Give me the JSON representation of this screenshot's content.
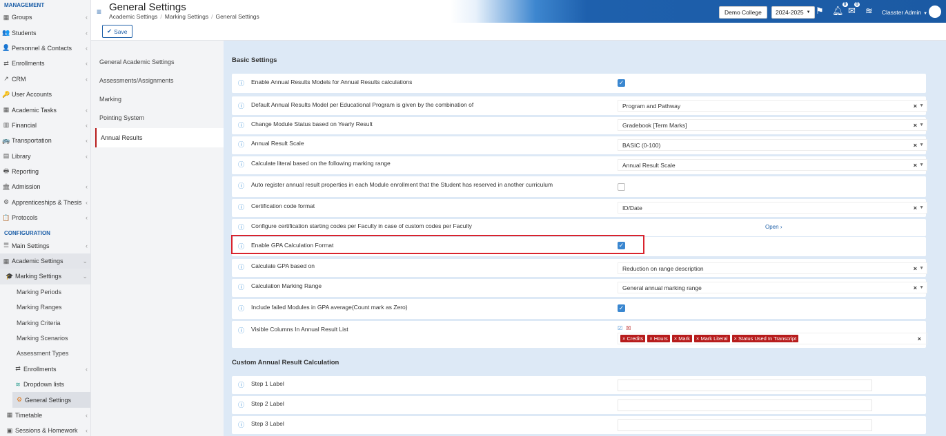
{
  "sidebar": {
    "management_heading": "MANAGEMENT",
    "configuration_heading": "CONFIGURATION",
    "management_items": [
      {
        "label": "Groups",
        "icon": "groups-icon"
      },
      {
        "label": "Students",
        "icon": "students-icon"
      },
      {
        "label": "Personnel & Contacts",
        "icon": "personnel-icon"
      },
      {
        "label": "Enrollments",
        "icon": "enrollments-icon"
      },
      {
        "label": "CRM",
        "icon": "crm-icon"
      },
      {
        "label": "User Accounts",
        "icon": "user-accounts-icon"
      },
      {
        "label": "Academic Tasks",
        "icon": "academic-tasks-icon"
      },
      {
        "label": "Financial",
        "icon": "financial-icon"
      },
      {
        "label": "Transportation",
        "icon": "transportation-icon"
      },
      {
        "label": "Library",
        "icon": "library-icon"
      },
      {
        "label": "Reporting",
        "icon": "reporting-icon"
      },
      {
        "label": "Admission",
        "icon": "admission-icon"
      },
      {
        "label": "Apprenticeships & Thesis",
        "icon": "apprenticeships-icon"
      },
      {
        "label": "Protocols",
        "icon": "protocols-icon"
      }
    ],
    "config_items": {
      "main_settings": "Main Settings",
      "academic_settings": "Academic Settings",
      "marking_settings": "Marking Settings",
      "marking_periods": "Marking Periods",
      "marking_ranges": "Marking Ranges",
      "marking_criteria": "Marking Criteria",
      "marking_scenarios": "Marking Scenarios",
      "assessment_types": "Assessment Types",
      "enrollments": "Enrollments",
      "dropdown_lists": "Dropdown lists",
      "general_settings": "General Settings",
      "timetable": "Timetable",
      "sessions_homework": "Sessions & Homework"
    }
  },
  "header": {
    "title": "General Settings",
    "breadcrumb": [
      "Academic Settings",
      "Marking Settings",
      "General Settings"
    ],
    "college": "Demo College",
    "year": "2024-2025",
    "notif_count": "0",
    "mail_count": "0",
    "user": "Classter Admin"
  },
  "toolbar": {
    "save_label": "Save"
  },
  "settings_nav": [
    "General Academic Settings",
    "Assessments/Assignments",
    "Marking",
    "Pointing System",
    "Annual Results"
  ],
  "main": {
    "basic_title": "Basic Settings",
    "custom_title": "Custom Annual Result Calculation",
    "rows": [
      {
        "label": "Enable Annual Results Models for Annual Results calculations",
        "checked": true
      },
      {
        "label": "Default Annual Results Model per Educational Program is given by the combination of",
        "value": "Program and Pathway"
      },
      {
        "label": "Change Module Status based on Yearly Result",
        "value": "Gradebook [Term Marks]"
      },
      {
        "label": "Annual Result Scale",
        "value": "BASIC (0-100)"
      },
      {
        "label": "Calculate literal based on the following marking range",
        "value": "Annual Result Scale"
      },
      {
        "label": "Auto register annual result properties in each Module enrollment that the Student has reserved in another curriculum",
        "checked": false
      },
      {
        "label": "Certification code format",
        "value": "ID/Date"
      },
      {
        "label": "Configure certification starting codes per Faculty in case of custom codes per Faculty",
        "link": "Open"
      },
      {
        "label": "Enable GPA Calculation Format",
        "checked": true
      },
      {
        "label": "Calculate GPA based on",
        "value": "Reduction on range description"
      },
      {
        "label": "Calculation Marking Range",
        "value": "General annual marking range"
      },
      {
        "label": "Include failed Modules in GPA average(Count mark as Zero)",
        "checked": true
      },
      {
        "label": "Visible Columns In Annual Result List",
        "tags": [
          "Credits",
          "Hours",
          "Mark",
          "Mark Literal",
          "Status Used In Transcript"
        ]
      }
    ],
    "custom_rows": [
      {
        "label": "Step 1 Label"
      },
      {
        "label": "Step 2 Label"
      },
      {
        "label": "Step 3 Label"
      }
    ]
  },
  "colors": {
    "accent": "#1d5fa8",
    "highlight": "#d9232d",
    "tag": "#b71c1c"
  }
}
